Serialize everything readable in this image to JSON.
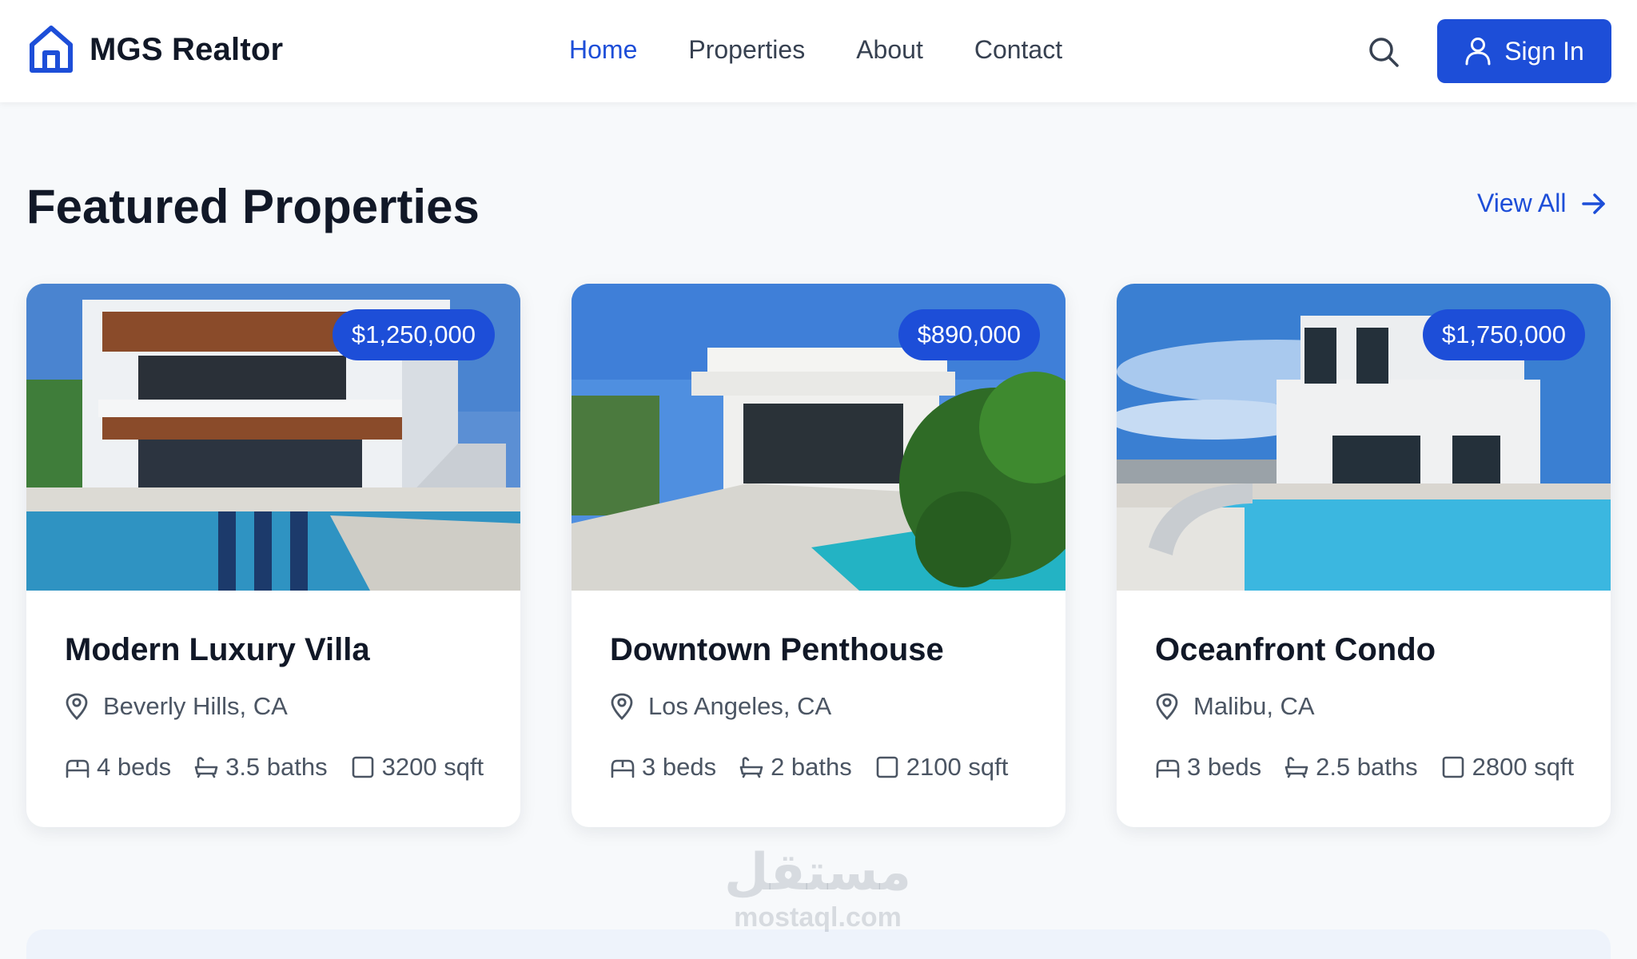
{
  "header": {
    "brand_name": "MGS Realtor",
    "nav": [
      {
        "label": "Home",
        "active": true
      },
      {
        "label": "Properties",
        "active": false
      },
      {
        "label": "About",
        "active": false
      },
      {
        "label": "Contact",
        "active": false
      }
    ],
    "signin_label": "Sign In"
  },
  "section": {
    "title": "Featured Properties",
    "view_all_label": "View All"
  },
  "properties": [
    {
      "price": "$1,250,000",
      "title": "Modern Luxury Villa",
      "location": "Beverly Hills, CA",
      "beds": "4 beds",
      "baths": "3.5 baths",
      "sqft": "3200 sqft"
    },
    {
      "price": "$890,000",
      "title": "Downtown Penthouse",
      "location": "Los Angeles, CA",
      "beds": "3 beds",
      "baths": "2 baths",
      "sqft": "2100 sqft"
    },
    {
      "price": "$1,750,000",
      "title": "Oceanfront Condo",
      "location": "Malibu, CA",
      "beds": "3 beds",
      "baths": "2.5 baths",
      "sqft": "2800 sqft"
    }
  ],
  "watermark": {
    "logo_text": "مستقل",
    "site": "mostaql.com"
  },
  "colors": {
    "primary": "#1d4ed8",
    "text": "#111827",
    "muted": "#4b5563",
    "background": "#f7f9fb"
  },
  "icons": [
    "home-icon",
    "search-icon",
    "user-icon",
    "arrow-right-icon",
    "map-pin-icon",
    "bed-icon",
    "bath-icon",
    "square-icon"
  ]
}
